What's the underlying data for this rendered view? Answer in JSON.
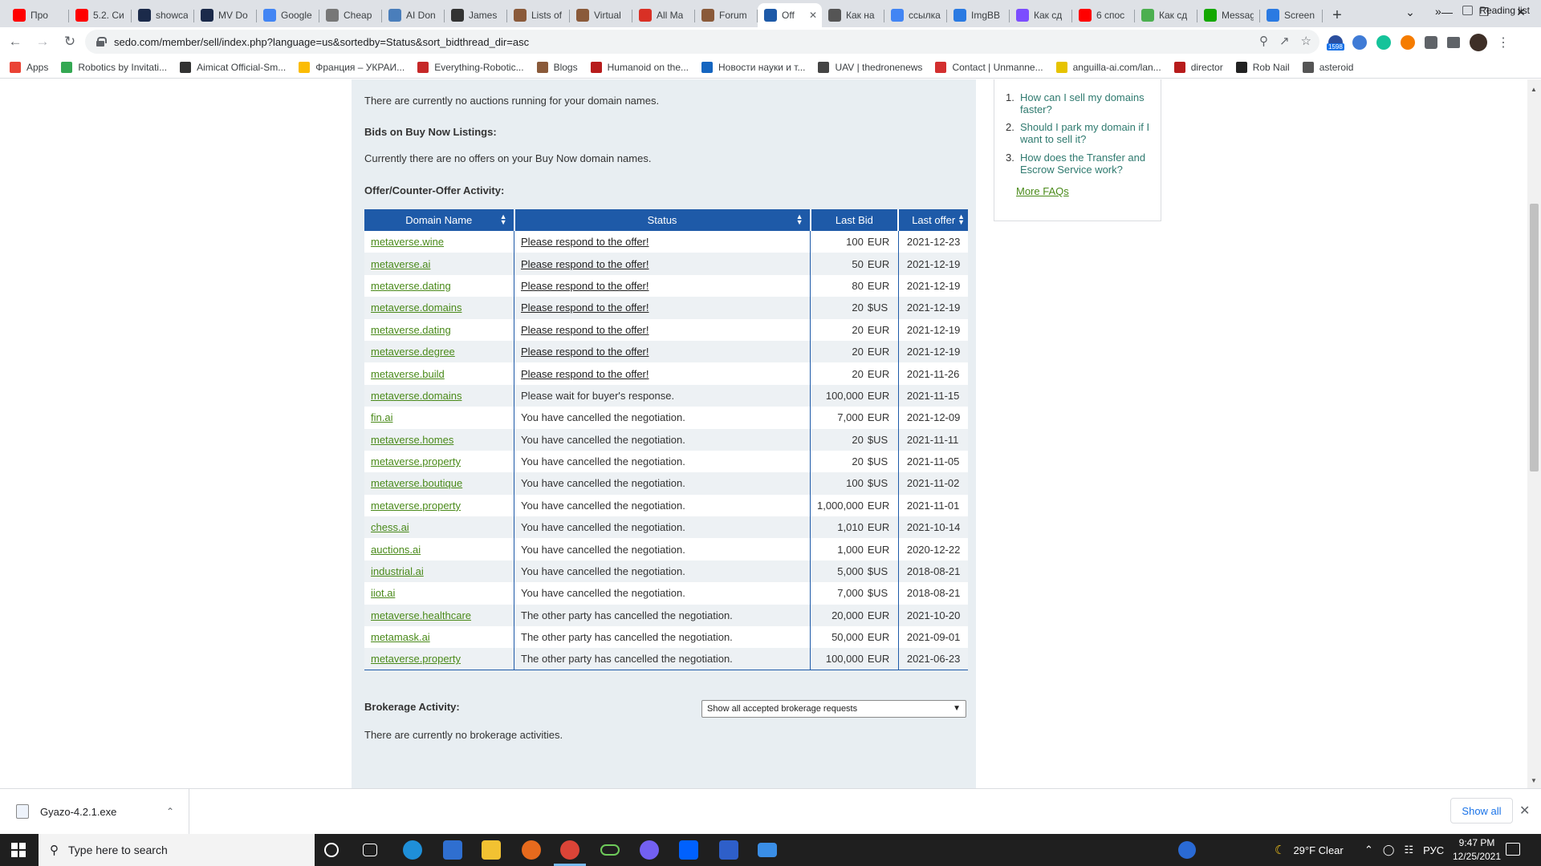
{
  "browser": {
    "tabs": [
      {
        "label": "Про",
        "icon": "youtube-icon",
        "color": "#ff0000"
      },
      {
        "label": "5.2. Си",
        "icon": "youtube-icon",
        "color": "#ff0000"
      },
      {
        "label": "showca",
        "icon": "np-icon",
        "color": "#1b2a4a"
      },
      {
        "label": "MV Do",
        "icon": "np-icon",
        "color": "#1b2a4a"
      },
      {
        "label": "Google",
        "icon": "google-translate-icon",
        "color": "#4285f4"
      },
      {
        "label": "Cheap",
        "icon": "page-icon",
        "color": "#777777"
      },
      {
        "label": "AI Don",
        "icon": "globe-icon",
        "color": "#4a7ebb"
      },
      {
        "label": "James",
        "icon": "wikipedia-icon",
        "color": "#333333"
      },
      {
        "label": "Lists of",
        "icon": "forum-icon",
        "color": "#8a5a3a"
      },
      {
        "label": "Virtual",
        "icon": "forum-icon",
        "color": "#8a5a3a"
      },
      {
        "label": "All Ma",
        "icon": "gmail-icon",
        "color": "#d93025"
      },
      {
        "label": "Forum",
        "icon": "forum-icon",
        "color": "#8a5a3a"
      },
      {
        "label": "Off",
        "icon": "sedo-icon",
        "color": "#1e5aa8",
        "active": true
      },
      {
        "label": "Как на",
        "icon": "globe-icon",
        "color": "#555555"
      },
      {
        "label": "ссылка",
        "icon": "google-icon",
        "color": "#4285f4"
      },
      {
        "label": "ImgBB",
        "icon": "imgbb-icon",
        "color": "#2a7ae2"
      },
      {
        "label": "Как сд",
        "icon": "app-icon",
        "color": "#7c4dff"
      },
      {
        "label": "6 спос",
        "icon": "youtube-icon",
        "color": "#ff0000"
      },
      {
        "label": "Как сд",
        "icon": "app-icon",
        "color": "#4caf50"
      },
      {
        "label": "Messag",
        "icon": "upwork-icon",
        "color": "#14a800"
      },
      {
        "label": "Screen",
        "icon": "imgbb-icon",
        "color": "#2a7ae2"
      }
    ],
    "url": "sedo.com/member/sell/index.php?language=us&sortedby=Status&sort_bidthread_dir=asc",
    "extension_badge": "1598",
    "bookmarks": [
      {
        "label": "Apps",
        "color": "#ea4335"
      },
      {
        "label": "Robotics by Invitati...",
        "color": "#34a853"
      },
      {
        "label": "Aimicat Official-Sm...",
        "color": "#333333"
      },
      {
        "label": "Франция – УКРАИ...",
        "color": "#fbbc05"
      },
      {
        "label": "Everything-Robotic...",
        "color": "#c62828"
      },
      {
        "label": "Blogs",
        "color": "#8a5a3a"
      },
      {
        "label": "Humanoid on the...",
        "color": "#b71c1c"
      },
      {
        "label": "Новости науки и т...",
        "color": "#1565c0"
      },
      {
        "label": "UAV | thedronenews",
        "color": "#444444"
      },
      {
        "label": "Contact | Unmanne...",
        "color": "#d32f2f"
      },
      {
        "label": "anguilla-ai.com/lan...",
        "color": "#e6c300"
      },
      {
        "label": "director",
        "color": "#b71c1c"
      },
      {
        "label": "Rob Nail",
        "color": "#222222"
      },
      {
        "label": "asteroid",
        "color": "#555555"
      }
    ],
    "reading_list": "Reading list"
  },
  "page": {
    "auctions_text": "There are currently no auctions running for your domain names.",
    "buy_now_heading": "Bids on Buy Now Listings:",
    "buy_now_text": "Currently there are no offers on your Buy Now domain names.",
    "offer_heading": "Offer/Counter-Offer Activity:",
    "table": {
      "headers": {
        "domain": "Domain Name",
        "status": "Status",
        "last_bid": "Last Bid",
        "last_offer": "Last offer"
      },
      "rows": [
        {
          "domain": "metaverse.wine",
          "status": "Please respond to the offer!",
          "link": true,
          "bid": "100",
          "cur": "EUR",
          "date": "2021-12-23"
        },
        {
          "domain": "metaverse.ai",
          "status": "Please respond to the offer!",
          "link": true,
          "bid": "50",
          "cur": "EUR",
          "date": "2021-12-19"
        },
        {
          "domain": "metaverse.dating",
          "status": "Please respond to the offer!",
          "link": true,
          "bid": "80",
          "cur": "EUR",
          "date": "2021-12-19"
        },
        {
          "domain": "metaverse.domains",
          "status": "Please respond to the offer!",
          "link": true,
          "bid": "20",
          "cur": "$US",
          "date": "2021-12-19"
        },
        {
          "domain": "metaverse.dating",
          "status": "Please respond to the offer!",
          "link": true,
          "bid": "20",
          "cur": "EUR",
          "date": "2021-12-19"
        },
        {
          "domain": "metaverse.degree",
          "status": "Please respond to the offer!",
          "link": true,
          "bid": "20",
          "cur": "EUR",
          "date": "2021-12-19"
        },
        {
          "domain": "metaverse.build",
          "status": "Please respond to the offer!",
          "link": true,
          "bid": "20",
          "cur": "EUR",
          "date": "2021-11-26"
        },
        {
          "domain": "metaverse.domains",
          "status": "Please wait for buyer's response.",
          "link": false,
          "bid": "100,000",
          "cur": "EUR",
          "date": "2021-11-15"
        },
        {
          "domain": "fin.ai",
          "status": "You have cancelled the negotiation.",
          "link": false,
          "bid": "7,000",
          "cur": "EUR",
          "date": "2021-12-09"
        },
        {
          "domain": "metaverse.homes",
          "status": "You have cancelled the negotiation.",
          "link": false,
          "bid": "20",
          "cur": "$US",
          "date": "2021-11-11"
        },
        {
          "domain": "metaverse.property",
          "status": "You have cancelled the negotiation.",
          "link": false,
          "bid": "20",
          "cur": "$US",
          "date": "2021-11-05"
        },
        {
          "domain": "metaverse.boutique",
          "status": "You have cancelled the negotiation.",
          "link": false,
          "bid": "100",
          "cur": "$US",
          "date": "2021-11-02"
        },
        {
          "domain": "metaverse.property",
          "status": "You have cancelled the negotiation.",
          "link": false,
          "bid": "1,000,000",
          "cur": "EUR",
          "date": "2021-11-01"
        },
        {
          "domain": "chess.ai",
          "status": "You have cancelled the negotiation.",
          "link": false,
          "bid": "1,010",
          "cur": "EUR",
          "date": "2021-10-14"
        },
        {
          "domain": "auctions.ai",
          "status": "You have cancelled the negotiation.",
          "link": false,
          "bid": "1,000",
          "cur": "EUR",
          "date": "2020-12-22"
        },
        {
          "domain": "industrial.ai",
          "status": "You have cancelled the negotiation.",
          "link": false,
          "bid": "5,000",
          "cur": "$US",
          "date": "2018-08-21"
        },
        {
          "domain": "iiot.ai",
          "status": "You have cancelled the negotiation.",
          "link": false,
          "bid": "7,000",
          "cur": "$US",
          "date": "2018-08-21"
        },
        {
          "domain": "metaverse.healthcare",
          "status": "The other party has cancelled the negotiation.",
          "link": false,
          "bid": "20,000",
          "cur": "EUR",
          "date": "2021-10-20"
        },
        {
          "domain": "metamask.ai",
          "status": "The other party has cancelled the negotiation.",
          "link": false,
          "bid": "50,000",
          "cur": "EUR",
          "date": "2021-09-01"
        },
        {
          "domain": "metaverse.property",
          "status": "The other party has cancelled the negotiation.",
          "link": false,
          "bid": "100,000",
          "cur": "EUR",
          "date": "2021-06-23"
        }
      ]
    },
    "brokerage_heading": "Brokerage Activity:",
    "brokerage_select": "Show all accepted brokerage requests",
    "brokerage_text": "There are currently no brokerage activities.",
    "faq": {
      "items": [
        {
          "num": "1.",
          "text": "How can I sell my domains faster?"
        },
        {
          "num": "2.",
          "text": "Should I park my domain if I want to sell it?"
        },
        {
          "num": "3.",
          "text": "How does the Transfer and Escrow Service work?"
        }
      ],
      "more": "More FAQs"
    }
  },
  "download_bar": {
    "file": "Gyazo-4.2.1.exe",
    "show_all": "Show all"
  },
  "taskbar": {
    "search_placeholder": "Type here to search",
    "weather": "29°F  Clear",
    "language": "РУС",
    "time": "9:47 PM",
    "date": "12/25/2021"
  },
  "colors": {
    "header_blue": "#1e5aa8",
    "link_green": "#4a8a1a",
    "faq_teal": "#2f7a6f",
    "panel_bg": "#e8eef2"
  }
}
